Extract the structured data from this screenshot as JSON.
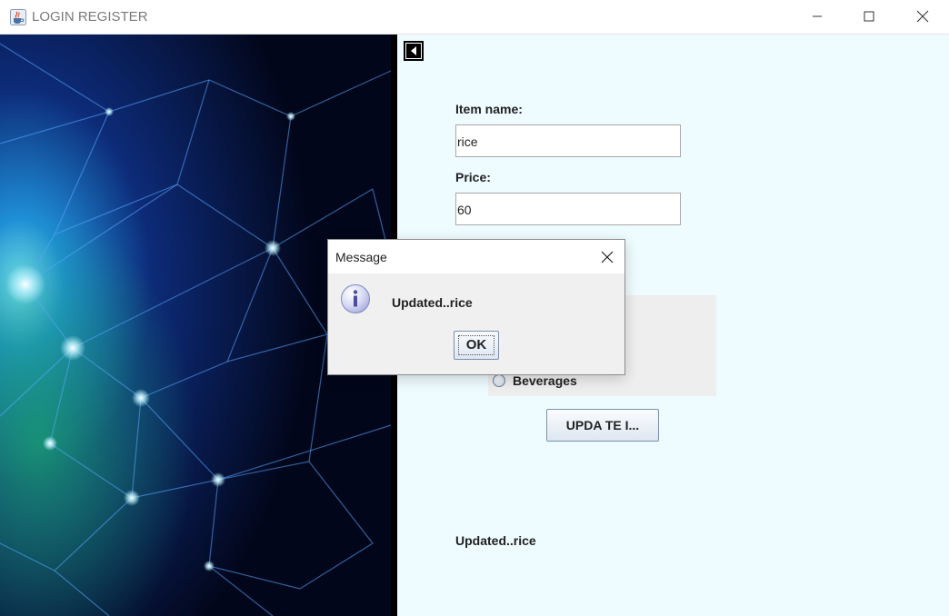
{
  "window": {
    "title": "LOGIN REGISTER",
    "icon": "java-cup-icon",
    "controls": [
      "minimize-icon",
      "maximize-icon",
      "close-icon"
    ]
  },
  "form": {
    "back_icon": "arrow-left-icon",
    "item_name_label": "Item name:",
    "item_name_value": "rice",
    "price_label": "Price:",
    "price_value": "60",
    "category_option_visible": "Beverages",
    "update_button_label": "UPDA TE I...",
    "status_text": "Updated..rice"
  },
  "dialog": {
    "title": "Message",
    "icon": "info-icon",
    "message": "Updated..rice",
    "ok_label": "OK"
  },
  "colors": {
    "form_background": "#eefbff",
    "radio_group_background": "#eeeeee",
    "dialog_background": "#f0f0f0"
  }
}
